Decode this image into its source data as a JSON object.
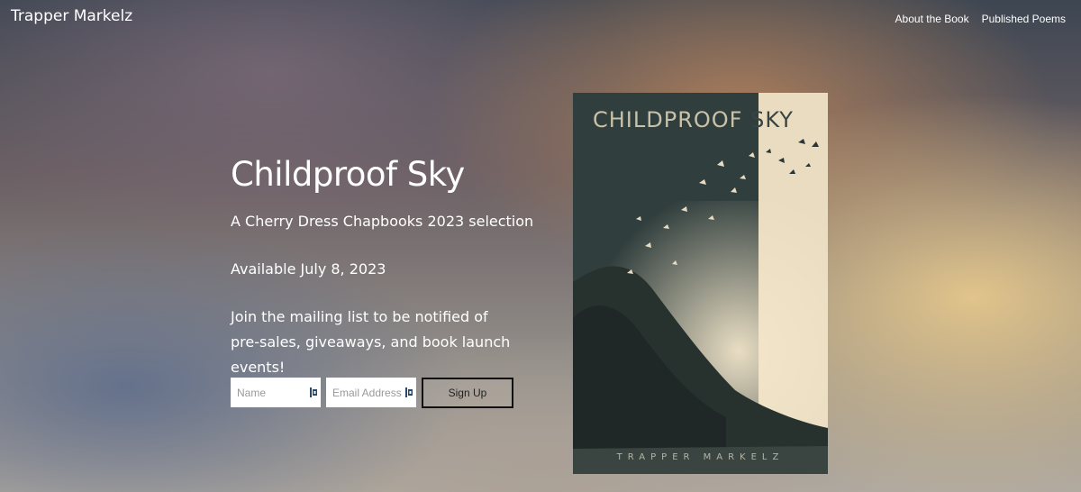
{
  "header": {
    "site_title": "Trapper Markelz",
    "nav": [
      {
        "label": "About the Book"
      },
      {
        "label": "Published Poems"
      }
    ]
  },
  "hero": {
    "title": "Childproof Sky",
    "subtitle": "A Cherry Dress Chapbooks 2023 selection",
    "availability": "Available July 8, 2023",
    "mailing_text": "Join the mailing list to be notified of pre-sales, giveaways, and book launch events!"
  },
  "form": {
    "name_placeholder": "Name",
    "email_placeholder": "Email Address",
    "signup_label": "Sign Up",
    "field_icon": "password-manager-icon"
  },
  "cover": {
    "title_part1": "CHILDPROOF ",
    "title_part2": "SKY",
    "author": "TRAPPER MARKELZ"
  },
  "colors": {
    "text": "#ffffff",
    "cover_dark": "#303e3d",
    "cover_light": "#efe3c9",
    "button_border": "#111111"
  }
}
